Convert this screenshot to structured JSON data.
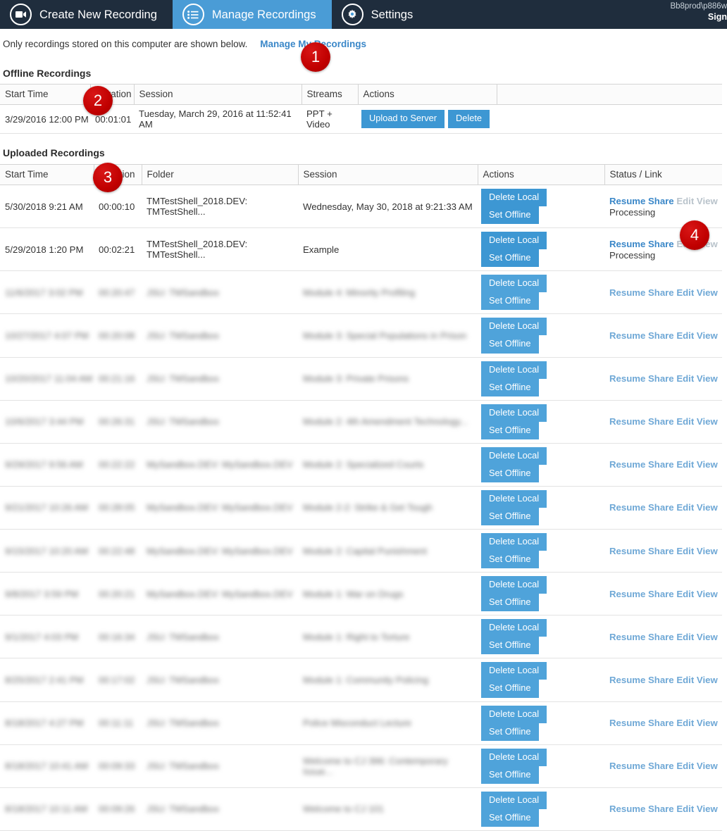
{
  "nav": {
    "items": [
      {
        "label": "Create New Recording",
        "icon": "video-camera-icon",
        "active": false
      },
      {
        "label": "Manage Recordings",
        "icon": "list-icon",
        "active": true
      },
      {
        "label": "Settings",
        "icon": "gear-icon",
        "active": false
      }
    ],
    "user": "Bb8prod\\p886w",
    "signout": "Sign"
  },
  "subheader": {
    "notice": "Only recordings stored on this computer are shown below.",
    "link": "Manage My Recordings"
  },
  "offline": {
    "title": "Offline Recordings",
    "columns": [
      "Start Time",
      "Duration",
      "Session",
      "Streams",
      "Actions",
      ""
    ],
    "rows": [
      {
        "start_time": "3/29/2016 12:00 PM",
        "duration": "00:01:01",
        "session": "Tuesday, March 29, 2016 at 11:52:41 AM",
        "streams": "PPT + Video",
        "actions": [
          "Upload to Server",
          "Delete"
        ]
      }
    ]
  },
  "uploaded": {
    "title": "Uploaded Recordings",
    "columns": [
      "Start Time",
      "Duration",
      "Folder",
      "Session",
      "Actions",
      "Status / Link"
    ],
    "action_labels": [
      "Delete Local",
      "Set Offline"
    ],
    "link_labels": [
      "Resume",
      "Share",
      "Edit",
      "View"
    ],
    "processing_label": "Processing",
    "rows": [
      {
        "start_time": "5/30/2018 9:21 AM",
        "duration": "00:00:10",
        "folder": "TMTestShell_2018.DEV: TMTestShell...",
        "session": "Wednesday, May 30, 2018 at 9:21:33 AM",
        "status": "Processing",
        "dim_links": [
          "Edit",
          "View"
        ],
        "blurred": false
      },
      {
        "start_time": "5/29/2018 1:20 PM",
        "duration": "00:02:21",
        "folder": "TMTestShell_2018.DEV: TMTestShell...",
        "session": "Example",
        "status": "Processing",
        "dim_links": [
          "Edit",
          "View"
        ],
        "blurred": false
      },
      {
        "start_time": "11/6/2017 3:02 PM",
        "duration": "00:20:47",
        "folder": "JSU: TMSandbox",
        "session": "Module 4: Minority Profiling",
        "status": "",
        "dim_links": [],
        "blurred": true
      },
      {
        "start_time": "10/27/2017 4:07 PM",
        "duration": "00:20:08",
        "folder": "JSU: TMSandbox",
        "session": "Module 3: Special Populations in Prison",
        "status": "",
        "dim_links": [],
        "blurred": true
      },
      {
        "start_time": "10/20/2017 11:04 AM",
        "duration": "00:21:16",
        "folder": "JSU: TMSandbox",
        "session": "Module 3: Private Prisons",
        "status": "",
        "dim_links": [],
        "blurred": true
      },
      {
        "start_time": "10/6/2017 3:44 PM",
        "duration": "00:26:31",
        "folder": "JSU: TMSandbox",
        "session": "Module 2: 4th Amendment Technology...",
        "status": "",
        "dim_links": [],
        "blurred": true
      },
      {
        "start_time": "9/29/2017 9:56 AM",
        "duration": "00:22:22",
        "folder": "MySandbox.DEV: MySandbox.DEV",
        "session": "Module 2: Specialized Courts",
        "status": "",
        "dim_links": [],
        "blurred": true
      },
      {
        "start_time": "9/21/2017 10:26 AM",
        "duration": "00:28:05",
        "folder": "MySandbox.DEV: MySandbox.DEV",
        "session": "Module 2-2: Strike & Get Tough",
        "status": "",
        "dim_links": [],
        "blurred": true
      },
      {
        "start_time": "9/15/2017 10:20 AM",
        "duration": "00:22:48",
        "folder": "MySandbox.DEV: MySandbox.DEV",
        "session": "Module 2: Capital Punishment",
        "status": "",
        "dim_links": [],
        "blurred": true
      },
      {
        "start_time": "9/8/2017 3:59 PM",
        "duration": "00:20:21",
        "folder": "MySandbox.DEV: MySandbox.DEV",
        "session": "Module 1: War on Drugs",
        "status": "",
        "dim_links": [],
        "blurred": true
      },
      {
        "start_time": "9/1/2017 4:03 PM",
        "duration": "00:16:34",
        "folder": "JSU: TMSandbox",
        "session": "Module 1: Right to Torture",
        "status": "",
        "dim_links": [],
        "blurred": true
      },
      {
        "start_time": "8/25/2017 2:41 PM",
        "duration": "00:17:02",
        "folder": "JSU: TMSandbox",
        "session": "Module 1: Community Policing",
        "status": "",
        "dim_links": [],
        "blurred": true
      },
      {
        "start_time": "8/18/2017 4:27 PM",
        "duration": "00:11:11",
        "folder": "JSU: TMSandbox",
        "session": "Police Misconduct Lecture",
        "status": "",
        "dim_links": [],
        "blurred": true
      },
      {
        "start_time": "8/18/2017 10:41 AM",
        "duration": "00:09:33",
        "folder": "JSU: TMSandbox",
        "session": "Welcome to CJ 396: Contemporary Issue...",
        "status": "",
        "dim_links": [],
        "blurred": true
      },
      {
        "start_time": "8/18/2017 10:11 AM",
        "duration": "00:09:26",
        "folder": "JSU: TMSandbox",
        "session": "Welcome to CJ 101",
        "status": "",
        "dim_links": [],
        "blurred": true
      }
    ]
  },
  "badges": [
    {
      "number": "1"
    },
    {
      "number": "2"
    },
    {
      "number": "3"
    },
    {
      "number": "4"
    }
  ],
  "colors": {
    "nav_bg": "#1f2d3d",
    "nav_active": "#4a9cd6",
    "button_blue": "#3d97d3",
    "link_blue": "#3a87c8",
    "badge_red": "#c00000"
  }
}
